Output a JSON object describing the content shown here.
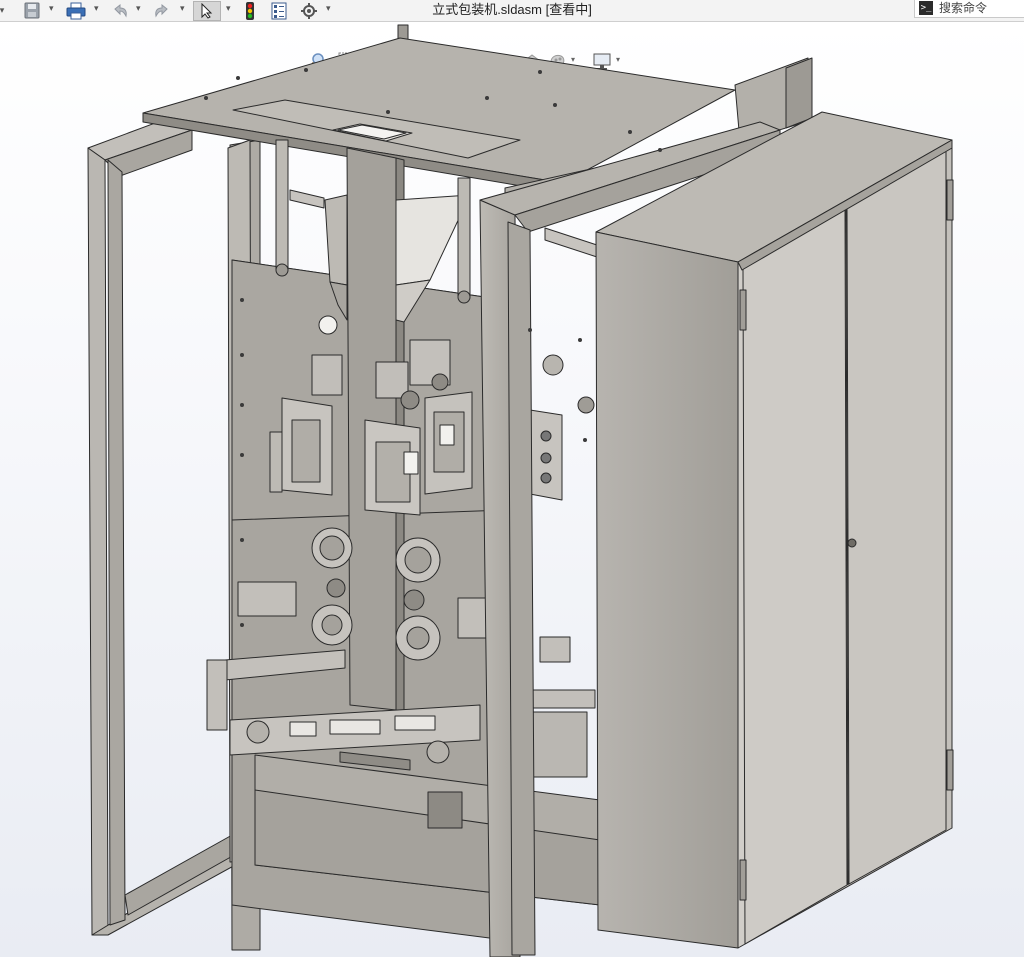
{
  "window": {
    "document_title": "立式包装机.sldasm [查看中]"
  },
  "toolbar": {
    "items": [
      {
        "icon": "save-icon"
      },
      {
        "icon": "print-icon"
      },
      {
        "icon": "undo-icon"
      },
      {
        "icon": "redo-icon"
      },
      {
        "icon": "select-pointer-icon"
      },
      {
        "icon": "traffic-light-icon"
      },
      {
        "icon": "file-properties-icon"
      },
      {
        "icon": "options-gear-icon"
      }
    ]
  },
  "search": {
    "placeholder": "搜索命令",
    "icon": "command-prompt-icon"
  },
  "view_toolbar": {
    "items": [
      {
        "icon": "zoom-to-fit-icon"
      },
      {
        "icon": "zoom-to-area-icon"
      },
      {
        "icon": "previous-view-icon"
      },
      {
        "icon": "section-view-icon"
      },
      {
        "icon": "dynamic-annotation-icon"
      },
      {
        "icon": "view-orientation-icon"
      },
      {
        "icon": "display-style-icon"
      },
      {
        "icon": "hide-show-items-icon"
      },
      {
        "icon": "edit-appearance-icon"
      },
      {
        "icon": "apply-scene-icon"
      },
      {
        "icon": "view-settings-icon"
      }
    ]
  },
  "colors": {
    "toolbar_bg": "#f3f3f3",
    "viewport_top": "#ffffff",
    "viewport_bottom": "#e9ecf3",
    "metal_light": "#c9c6c1",
    "metal_mid": "#a9a6a1",
    "metal_dark": "#86837e",
    "edge": "#2b2b2b",
    "accent_red": "#d22",
    "accent_blue": "#2a66c8"
  },
  "model": {
    "name": "vertical-packaging-machine-assembly"
  }
}
